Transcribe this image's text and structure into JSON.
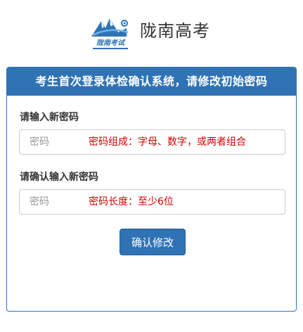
{
  "header": {
    "logo_icon": "mountain-logo-icon",
    "logo_text": "陇南考试",
    "title": "陇南高考"
  },
  "card": {
    "title": "考生首次登录体检确认系统，请修改初始密码",
    "password_field": {
      "label": "请输入新密码",
      "placeholder": "密码",
      "value": "",
      "hint": "密码组成：字母、数字，或两者组合"
    },
    "confirm_field": {
      "label": "请确认输入新密码",
      "placeholder": "密码",
      "value": "",
      "hint": "密码长度：至少6位"
    },
    "submit_label": "确认修改"
  },
  "colors": {
    "primary": "#2f73b5",
    "hint": "#d40000"
  }
}
